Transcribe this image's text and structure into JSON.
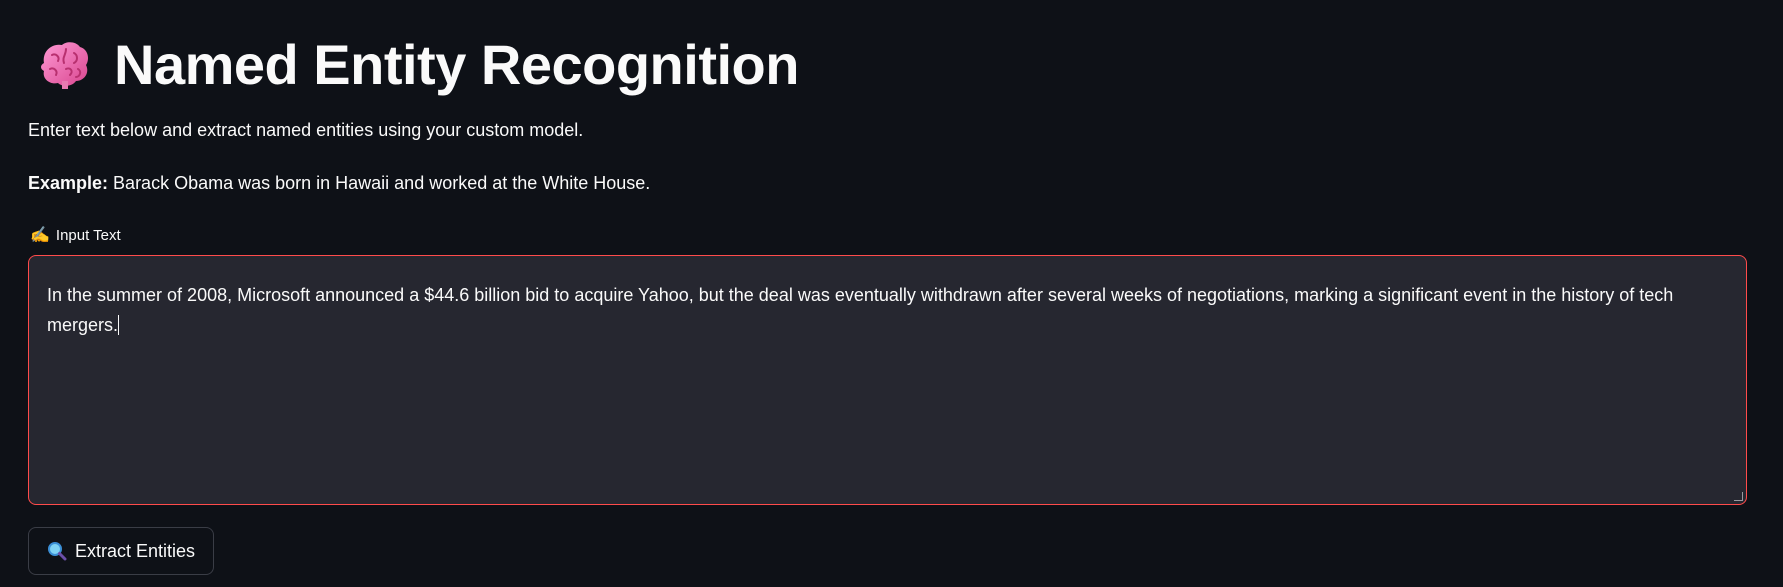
{
  "header": {
    "title": "Named Entity Recognition",
    "icon": "brain-icon"
  },
  "intro": {
    "description": "Enter text below and extract named entities using your custom model.",
    "example_label": "Example:",
    "example_text": " Barack Obama was born in Hawaii and worked at the White House."
  },
  "input": {
    "label_icon": "writing-hand-icon",
    "label": "Input Text",
    "value": "In the summer of 2008, Microsoft announced a $44.6 billion bid to acquire Yahoo, but the deal was eventually withdrawn after several weeks of negotiations, marking a significant event in the history of tech mergers.",
    "focus_border_color": "#ff4b4b"
  },
  "actions": {
    "extract_icon": "magnifying-glass-icon",
    "extract_label": "Extract Entities"
  },
  "colors": {
    "background": "#0e1117",
    "input_background": "#262730",
    "text": "#fafafa"
  }
}
